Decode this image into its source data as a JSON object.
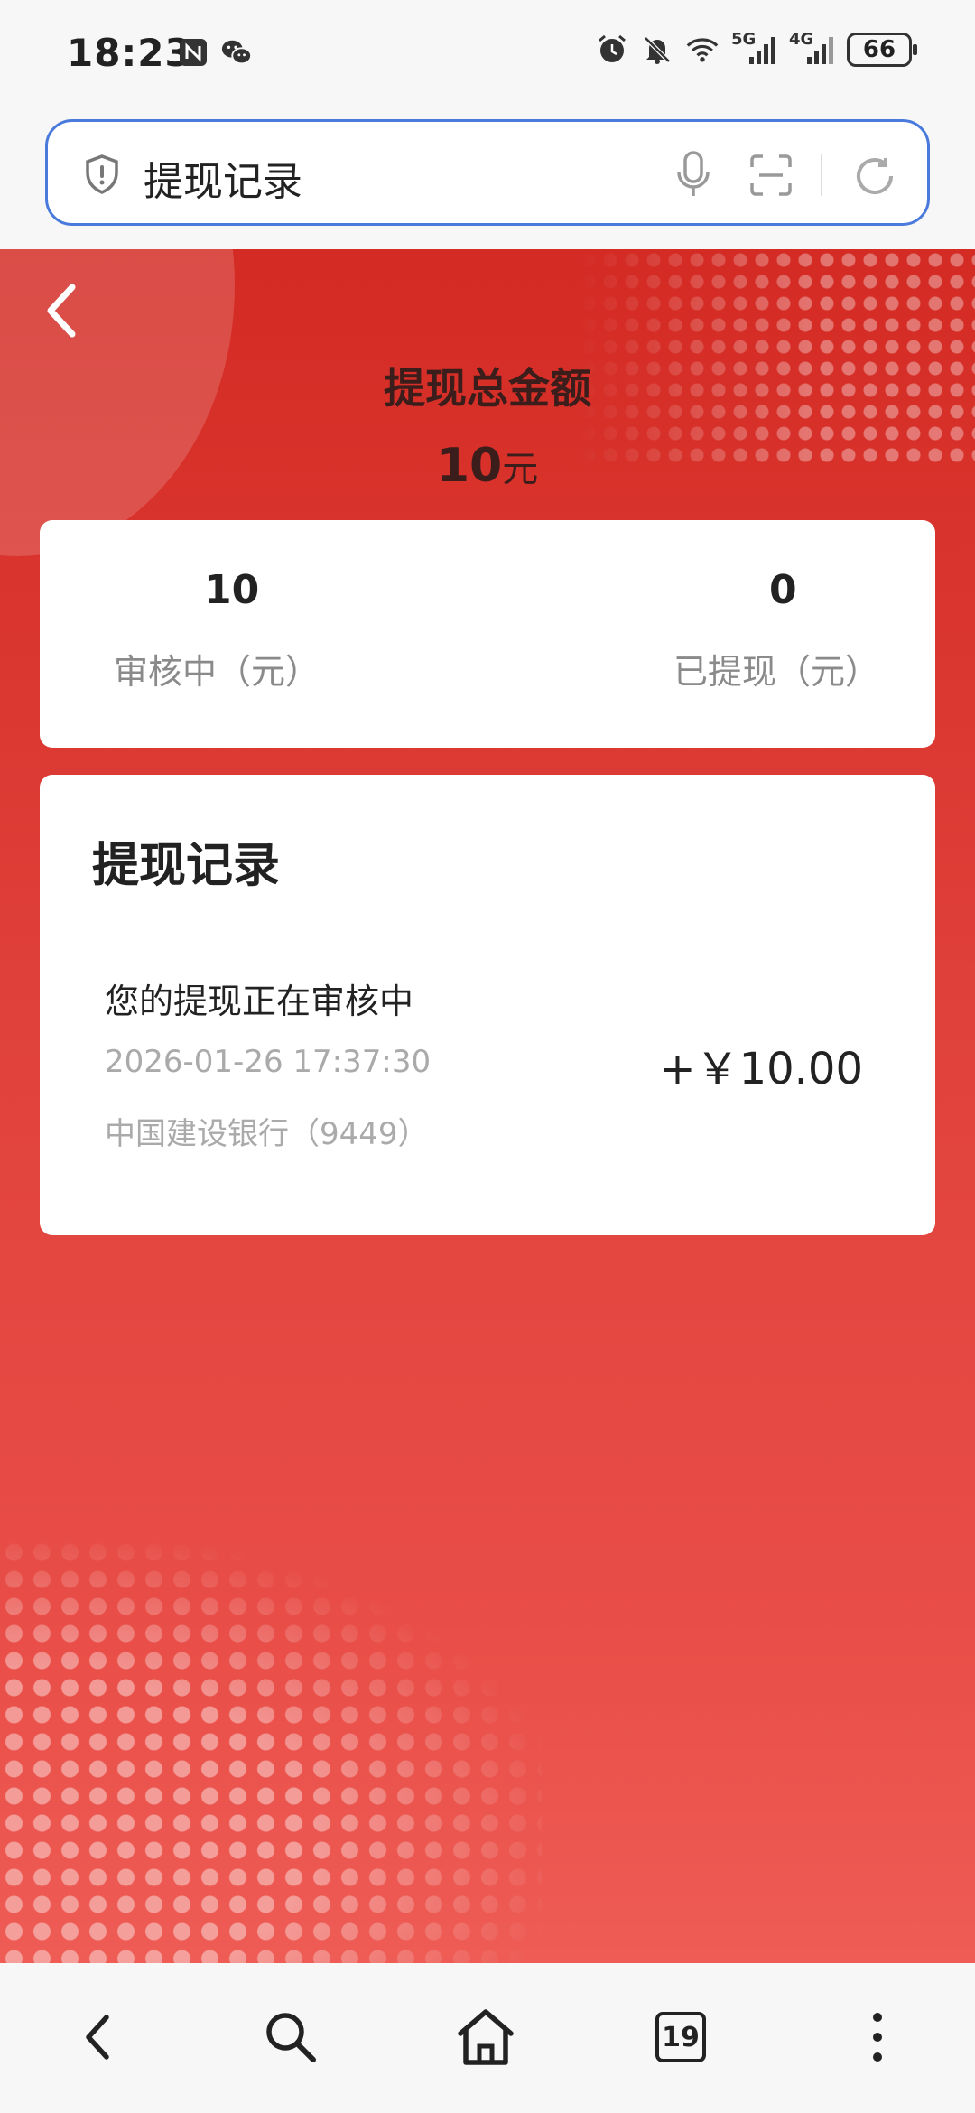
{
  "status_bar": {
    "time": "18:23",
    "network_5g": "5G",
    "network_4g": "4G",
    "battery": "66"
  },
  "address_bar": {
    "text": "提现记录"
  },
  "header": {
    "total_label": "提现总金额",
    "total_value": "10",
    "total_unit": "元"
  },
  "summary": {
    "pending_value": "10",
    "pending_label": "审核中（元）",
    "withdrawn_value": "0",
    "withdrawn_label": "已提现（元）"
  },
  "records": {
    "title": "提现记录",
    "items": [
      {
        "status": "您的提现正在审核中",
        "time": "2026-01-26 17:37:30",
        "bank": "中国建设银行（9449）",
        "amount": "+￥10.00"
      }
    ]
  },
  "bottom_nav": {
    "tab_count": "19"
  },
  "icons": {
    "back": "chevron-left-icon",
    "search": "search-icon",
    "home": "home-icon",
    "tabs": "tabs-icon",
    "more": "more-vertical-icon"
  },
  "colors": {
    "accent_red": "#d42b24",
    "address_border": "#4a7bdc"
  }
}
